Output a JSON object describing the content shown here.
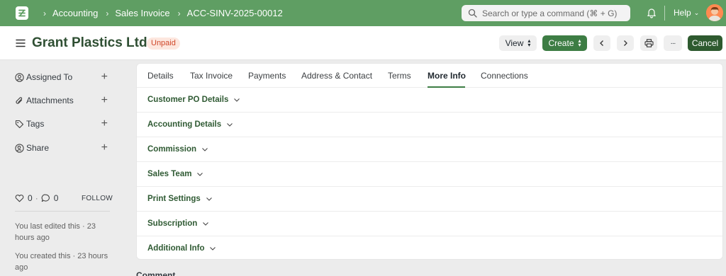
{
  "navbar": {
    "breadcrumbs": [
      "Accounting",
      "Sales Invoice",
      "ACC-SINV-2025-00012"
    ],
    "search_placeholder": "Search or type a command (⌘ + G)",
    "help_label": "Help",
    "brand_color": "#5f9e63"
  },
  "header": {
    "title": "Grant Plastics Ltd.",
    "status": "Unpaid",
    "view_label": "View",
    "create_label": "Create",
    "more_label": "···",
    "cancel_label": "Cancel"
  },
  "sidebar": {
    "items": [
      {
        "label": "Assigned To",
        "icon": "user-circle-icon"
      },
      {
        "label": "Attachments",
        "icon": "paperclip-icon"
      },
      {
        "label": "Tags",
        "icon": "tag-icon"
      },
      {
        "label": "Share",
        "icon": "share-user-icon"
      }
    ],
    "likes": "0",
    "comments": "0",
    "follow_label": "FOLLOW",
    "last_edited": "You last edited this · 23 hours ago",
    "created": "You created this · 23 hours ago"
  },
  "tabs": [
    "Details",
    "Tax Invoice",
    "Payments",
    "Address & Contact",
    "Terms",
    "More Info",
    "Connections"
  ],
  "active_tab": "More Info",
  "sections": [
    "Customer PO Details",
    "Accounting Details",
    "Commission",
    "Sales Team",
    "Print Settings",
    "Subscription",
    "Additional Info"
  ],
  "footer_heading": "Comment"
}
